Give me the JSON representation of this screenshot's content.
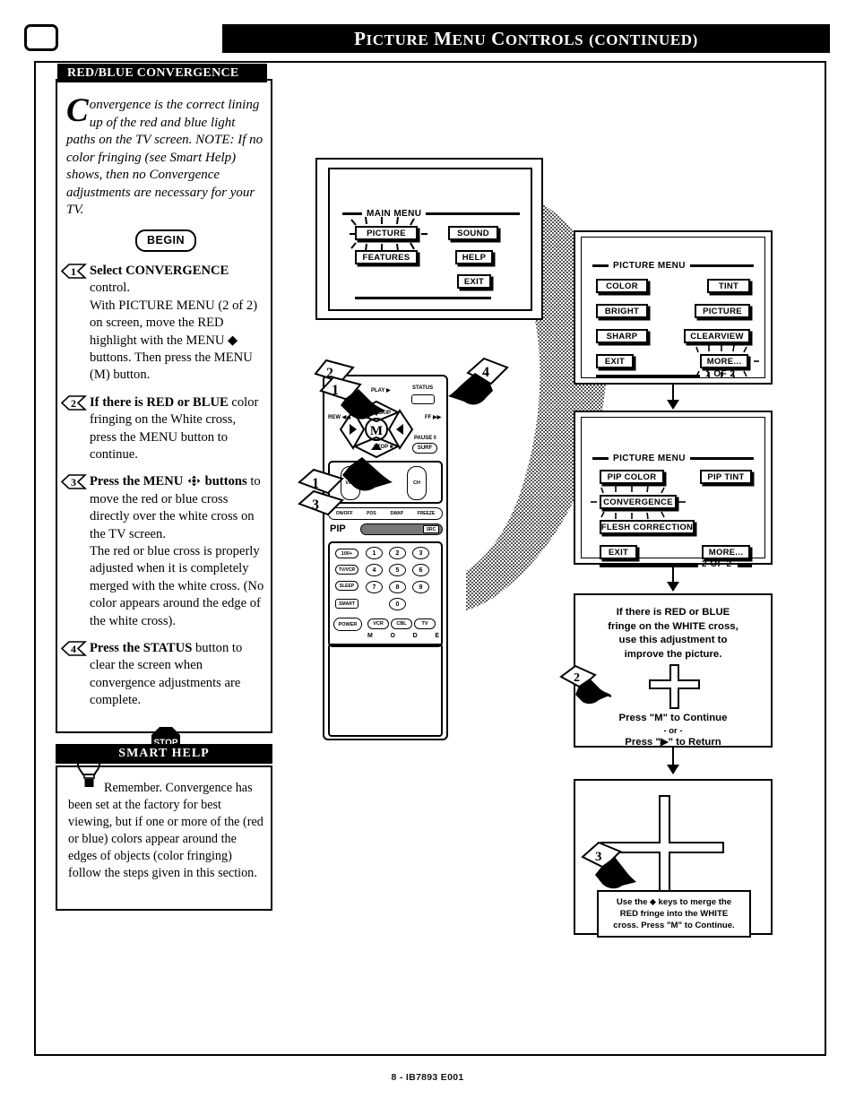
{
  "header": {
    "title_parts": [
      "P",
      "ICTURE ",
      "M",
      "ENU ",
      "C",
      "ONTROLS (",
      "CONTINUED",
      ")"
    ],
    "title": "PICTURE MENU CONTROLS (CONTINUED)",
    "tv_icon": "tv-icon"
  },
  "section": {
    "title": "RED/BLUE CONVERGENCE",
    "intro_dropcap": "C",
    "intro_rest": "onvergence is the correct lining up of the red and blue light paths on the TV screen. NOTE: If no color fringing (see Smart Help) shows, then no Convergence adjustments are necessary for your TV.",
    "begin_label": "BEGIN",
    "stop_label": "STOP",
    "steps": [
      {
        "num": "1",
        "lead_bold": "Select CONVERGENCE",
        "lead_rest": " control.",
        "paragraphs": [
          "With PICTURE MENU (2 of 2) on screen, move the RED highlight with the MENU ◆ buttons. Then press the MENU (M) button."
        ]
      },
      {
        "num": "2",
        "lead_bold": "If there is RED or BLUE",
        "lead_rest": " color fringing on the White cross, press the MENU button to continue.",
        "paragraphs": []
      },
      {
        "num": "3",
        "lead_bold": "Press the MENU",
        "lead_mid": " buttons",
        "lead_rest": " to move the red or blue cross directly over the white cross on the TV screen.",
        "paragraphs": [
          "The red or blue cross is properly adjusted when it is completely merged with the white cross. (No color appears around the edge of the white cross)."
        ]
      },
      {
        "num": "4",
        "lead_bold": "Press the STATUS",
        "lead_rest": " button to clear the screen when convergence adjustments are complete.",
        "paragraphs": []
      }
    ]
  },
  "smart_help": {
    "title": "SMART HELP",
    "icon": "lightbulb-icon",
    "body": "Remember. Convergence has been set at the factory for best viewing, but if one or more of the (red or blue) colors appear around the edges of objects (color fringing) follow the steps given in this section."
  },
  "tv_diagram": {
    "menu_label": "MAIN MENU",
    "buttons": [
      {
        "label": "PICTURE",
        "highlighted": true
      },
      {
        "label": "SOUND",
        "highlighted": false
      },
      {
        "label": "FEATURES",
        "highlighted": false
      },
      {
        "label": "HELP",
        "highlighted": false
      },
      {
        "label": "EXIT",
        "highlighted": false
      }
    ]
  },
  "picture_menu_1": {
    "menu_label": "PICTURE MENU",
    "page_indicator": "1 OF 2",
    "buttons": [
      {
        "label": "COLOR",
        "highlighted": false
      },
      {
        "label": "TINT",
        "highlighted": false
      },
      {
        "label": "BRIGHT",
        "highlighted": false
      },
      {
        "label": "PICTURE",
        "highlighted": false
      },
      {
        "label": "SHARP",
        "highlighted": false
      },
      {
        "label": "CLEARVIEW",
        "highlighted": false
      },
      {
        "label": "EXIT",
        "highlighted": false
      },
      {
        "label": "MORE...",
        "highlighted": true
      }
    ]
  },
  "picture_menu_2": {
    "menu_label": "PICTURE MENU",
    "page_indicator": "2 OF 2",
    "buttons": [
      {
        "label": "PIP COLOR",
        "highlighted": false
      },
      {
        "label": "PIP TINT",
        "highlighted": false
      },
      {
        "label": "CONVERGENCE",
        "highlighted": true
      },
      {
        "label": "FLESH CORRECTION",
        "highlighted": false
      },
      {
        "label": "EXIT",
        "highlighted": false
      },
      {
        "label": "MORE...",
        "highlighted": false
      }
    ]
  },
  "convergence_panel": {
    "line1": "If  there is RED or BLUE",
    "line2": "fringe on the WHITE cross,",
    "line3": "use this adjustment to",
    "line4": "improve the picture.",
    "footer1": "Press \"M\" to Continue",
    "footer2": "- or -",
    "footer3": "Press \"▶\" to Return",
    "callout": "2"
  },
  "merge_panel": {
    "tip_line1": "Use the ⬥ keys to merge the",
    "tip_line2": "RED fringe into the WHITE",
    "tip_line3": "cross. Press \"M\" to Continue.",
    "callout": "3"
  },
  "remote": {
    "callouts": [
      "1",
      "2",
      "3",
      "4"
    ],
    "top_labels": {
      "play": "PLAY ▶",
      "status": "STATUS",
      "rew": "REW ◀◀",
      "ff": "FF ▶▶",
      "skip": "SKIP",
      "menu_center": "M",
      "stop": "STOP ■",
      "pause": "PAUSE ‖",
      "surf": "SURF"
    },
    "rocker_labels": {
      "vol": "VOL",
      "ch": "CH"
    },
    "pip_row": [
      "ON/OFF",
      "POS",
      "SWAP",
      "FREEZE"
    ],
    "pip_label": "PIP",
    "pip_src": "SRC",
    "keypad": [
      "1",
      "2",
      "3",
      "4",
      "5",
      "6",
      "7",
      "8",
      "9",
      "0"
    ],
    "side_buttons": [
      "100+",
      "TV/VCR",
      "SLEEP",
      "SMART"
    ],
    "power": "POWER",
    "modes": [
      "VCR",
      "CBL",
      "TV"
    ],
    "mode_word": [
      "M",
      "O",
      "D",
      "E"
    ]
  },
  "footer": {
    "text": "8 - IB7893 E001"
  },
  "colors": {
    "ink": "#000000",
    "paper": "#ffffff",
    "shade": "#9a9a9a"
  }
}
